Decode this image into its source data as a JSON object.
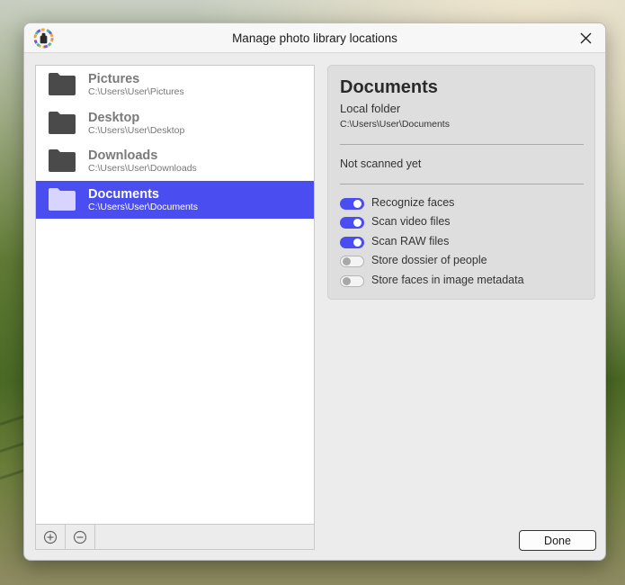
{
  "window": {
    "title": "Manage photo library locations"
  },
  "locations": [
    {
      "name": "Pictures",
      "path": "C:\\Users\\User\\Pictures",
      "selected": false
    },
    {
      "name": "Desktop",
      "path": "C:\\Users\\User\\Desktop",
      "selected": false
    },
    {
      "name": "Downloads",
      "path": "C:\\Users\\User\\Downloads",
      "selected": false
    },
    {
      "name": "Documents",
      "path": "C:\\Users\\User\\Documents",
      "selected": true
    }
  ],
  "details": {
    "title": "Documents",
    "type": "Local folder",
    "path": "C:\\Users\\User\\Documents",
    "status": "Not scanned yet",
    "options": [
      {
        "label": "Recognize faces",
        "enabled": true
      },
      {
        "label": "Scan video files",
        "enabled": true
      },
      {
        "label": "Scan RAW files",
        "enabled": true
      },
      {
        "label": "Store dossier of people",
        "enabled": false
      },
      {
        "label": "Store faces in image metadata",
        "enabled": false
      }
    ]
  },
  "footer": {
    "done_label": "Done"
  },
  "icons": {
    "app": "app-icon",
    "close": "close-icon",
    "folder": "folder-icon",
    "add": "add-circle-icon",
    "remove": "remove-circle-icon"
  },
  "colors": {
    "accent": "#4a4df0",
    "folder_dark": "#4a4a4a",
    "folder_selected": "#d7d4ff"
  }
}
